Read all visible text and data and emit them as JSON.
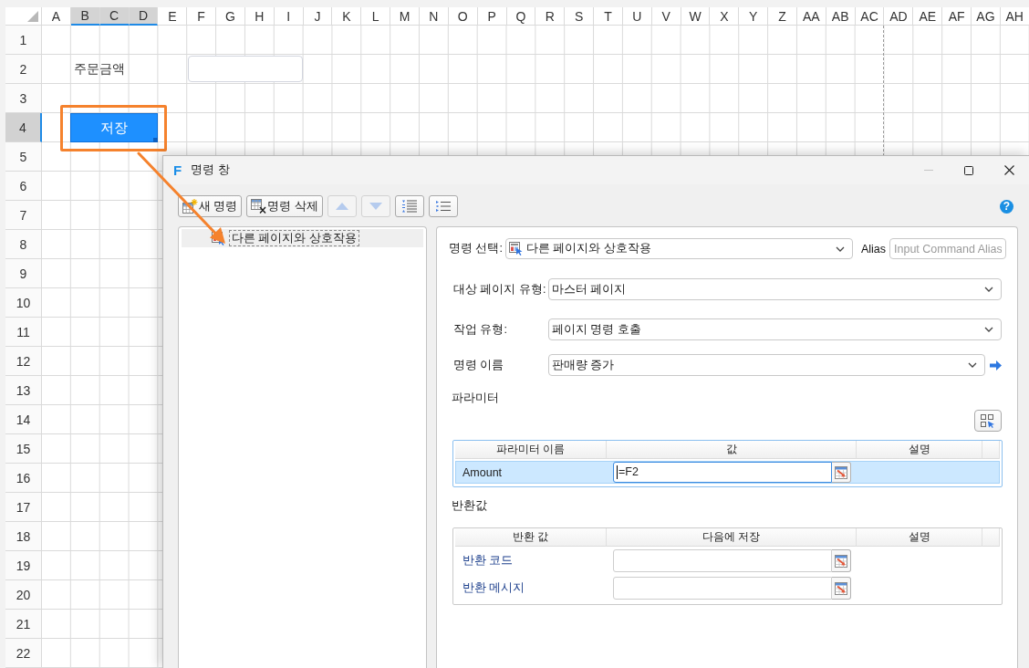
{
  "spreadsheet": {
    "columns": [
      {
        "label": "A",
        "selected": false
      },
      {
        "label": "B",
        "selected": true
      },
      {
        "label": "C",
        "selected": true
      },
      {
        "label": "D",
        "selected": true
      },
      {
        "label": "E",
        "selected": false
      },
      {
        "label": "F",
        "selected": false
      },
      {
        "label": "G",
        "selected": false
      },
      {
        "label": "H",
        "selected": false
      },
      {
        "label": "I",
        "selected": false
      },
      {
        "label": "J",
        "selected": false
      },
      {
        "label": "K",
        "selected": false
      },
      {
        "label": "L",
        "selected": false
      },
      {
        "label": "M",
        "selected": false
      },
      {
        "label": "N",
        "selected": false
      },
      {
        "label": "O",
        "selected": false
      },
      {
        "label": "P",
        "selected": false
      },
      {
        "label": "Q",
        "selected": false
      },
      {
        "label": "R",
        "selected": false
      },
      {
        "label": "S",
        "selected": false
      },
      {
        "label": "T",
        "selected": false
      },
      {
        "label": "U",
        "selected": false
      },
      {
        "label": "V",
        "selected": false
      },
      {
        "label": "W",
        "selected": false
      },
      {
        "label": "X",
        "selected": false
      },
      {
        "label": "Y",
        "selected": false
      },
      {
        "label": "Z",
        "selected": false
      },
      {
        "label": "AA",
        "selected": false
      },
      {
        "label": "AB",
        "selected": false
      },
      {
        "label": "AC",
        "selected": false
      },
      {
        "label": "AD",
        "selected": false
      },
      {
        "label": "AE",
        "selected": false
      },
      {
        "label": "AF",
        "selected": false
      },
      {
        "label": "AG",
        "selected": false
      },
      {
        "label": "AH",
        "selected": false
      }
    ],
    "rows": [
      {
        "label": "1",
        "selected": false
      },
      {
        "label": "2",
        "selected": false
      },
      {
        "label": "3",
        "selected": false
      },
      {
        "label": "4",
        "selected": true
      },
      {
        "label": "5",
        "selected": false
      },
      {
        "label": "6",
        "selected": false
      },
      {
        "label": "7",
        "selected": false
      },
      {
        "label": "8",
        "selected": false
      },
      {
        "label": "9",
        "selected": false
      },
      {
        "label": "10",
        "selected": false
      },
      {
        "label": "11",
        "selected": false
      },
      {
        "label": "12",
        "selected": false
      },
      {
        "label": "13",
        "selected": false
      },
      {
        "label": "14",
        "selected": false
      },
      {
        "label": "15",
        "selected": false
      },
      {
        "label": "16",
        "selected": false
      },
      {
        "label": "17",
        "selected": false
      },
      {
        "label": "18",
        "selected": false
      },
      {
        "label": "19",
        "selected": false
      },
      {
        "label": "20",
        "selected": false
      },
      {
        "label": "21",
        "selected": false
      },
      {
        "label": "22",
        "selected": false
      }
    ],
    "objects": [
      {
        "kind": "label",
        "text": "주문금액"
      },
      {
        "kind": "textbox"
      },
      {
        "kind": "button",
        "text": "저장",
        "selected": true
      }
    ]
  },
  "dialog": {
    "logo": "F",
    "title": "명령 창",
    "toolbar": [
      {
        "label": "새 명령",
        "disabled": false
      },
      {
        "label": "명령 삭제",
        "disabled": false
      },
      {
        "disabled": true
      },
      {
        "disabled": true
      },
      {
        "disabled": false
      },
      {
        "disabled": false
      }
    ],
    "help": "?",
    "command_tree": [
      {
        "label": "다른 페이지와 상호작용",
        "selected": true
      }
    ],
    "command_select": {
      "label": "명령 선택:",
      "value": "다른 페이지와 상호작용"
    },
    "alias": {
      "label": "Alias",
      "placeholder": "Input Command Alias"
    },
    "fields": [
      {
        "kind": "dropdown",
        "label": "대상 페이지 유형:",
        "value": "마스터 페이지"
      },
      {
        "kind": "dropdown",
        "label": "작업 유형:",
        "value": "페이지 명령 호출"
      },
      {
        "kind": "dropdown-link",
        "label": "명령 이름",
        "value": "판매량 증가"
      }
    ],
    "parameters": {
      "title": "파라미터",
      "columns": [
        "파라미터 이름",
        "값",
        "설명"
      ],
      "rows": [
        {
          "name": "Amount",
          "value": "=F2",
          "selected": true
        }
      ]
    },
    "return_values": {
      "title": "반환값",
      "columns": [
        "반환 값",
        "다음에 저장",
        "설명"
      ],
      "rows": [
        {
          "name": "반환 코드",
          "selected": false
        },
        {
          "name": "반환 메시지",
          "selected": false
        }
      ]
    }
  }
}
